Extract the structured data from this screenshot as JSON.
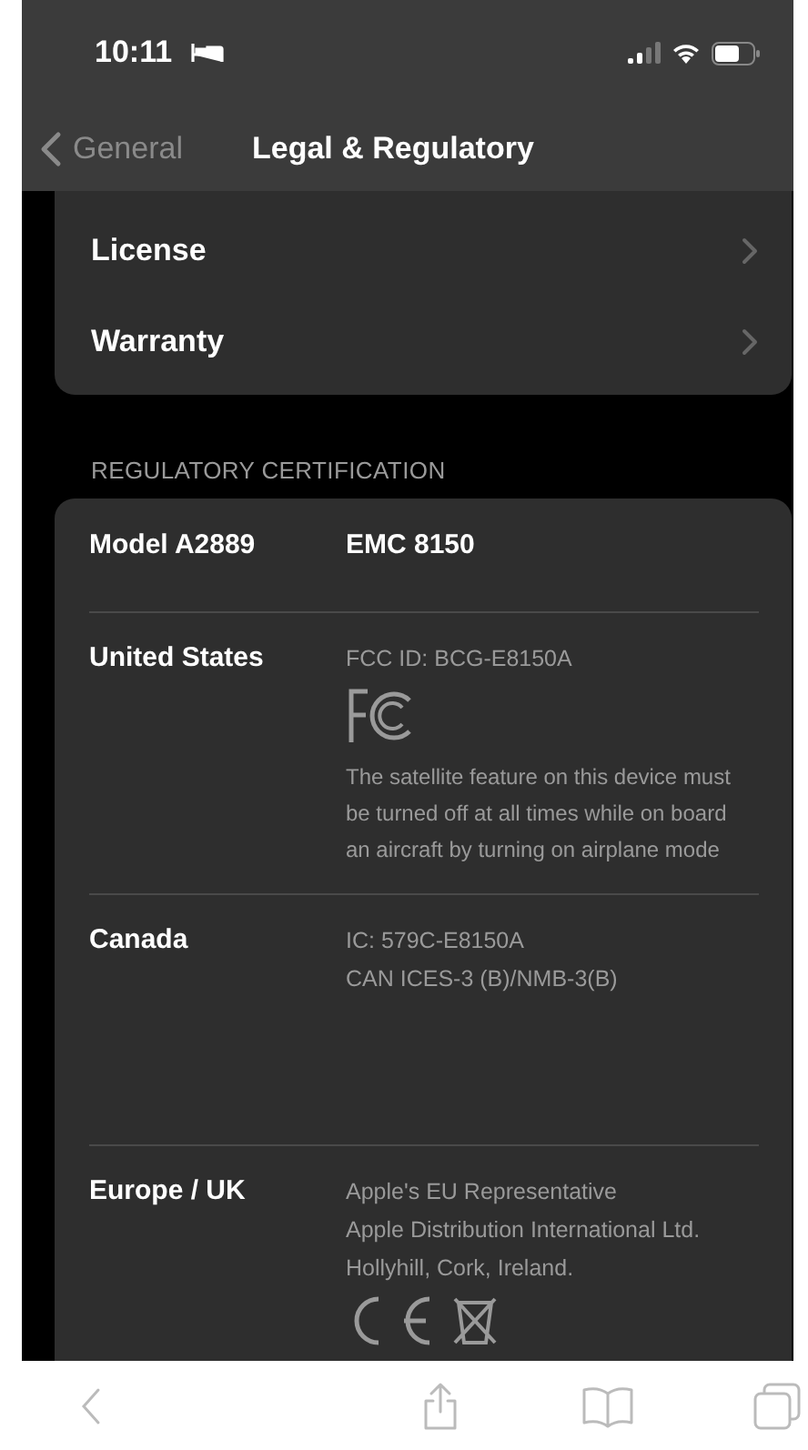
{
  "status_bar": {
    "time": "10:11"
  },
  "nav": {
    "back": "General",
    "title": "Legal & Regulatory"
  },
  "menu_items": [
    {
      "label": "License"
    },
    {
      "label": "Warranty"
    }
  ],
  "section_header": "REGULATORY CERTIFICATION",
  "certifications": [
    {
      "label": "Model A2889",
      "items": [
        {
          "kind": "strong",
          "text": "EMC 8150"
        }
      ]
    },
    {
      "label": "United States",
      "items": [
        {
          "kind": "text",
          "text": "FCC ID: BCG-E8150A"
        },
        {
          "kind": "logo"
        },
        {
          "kind": "note",
          "text": "The satellite feature on this device must be turned off at all times while on board an aircraft by turning on airplane mode"
        }
      ]
    },
    {
      "label": "Canada",
      "items": [
        {
          "kind": "text",
          "text": "IC: 579C-E8150A"
        },
        {
          "kind": "text",
          "text": "CAN ICES-3 (B)/NMB-3(B)"
        },
        {
          "kind": "spacer"
        }
      ]
    },
    {
      "label": "Europe / UK",
      "items": [
        {
          "kind": "text",
          "text": "Apple's EU Representative"
        },
        {
          "kind": "text",
          "text": "Apple Distribution International Ltd."
        },
        {
          "kind": "text",
          "text": "Hollyhill, Cork, Ireland."
        },
        {
          "kind": "marks"
        }
      ]
    }
  ]
}
